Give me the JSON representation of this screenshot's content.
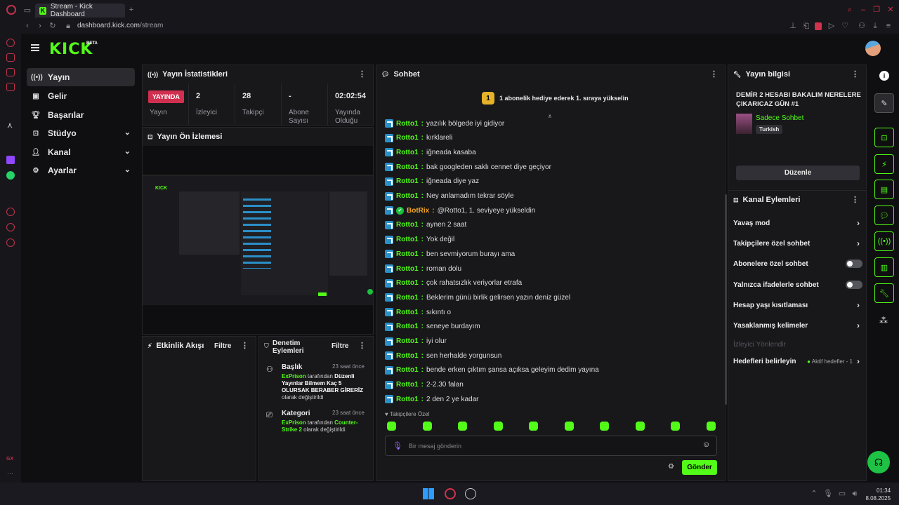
{
  "browser": {
    "tab_title": "Stream - Kick Dashboard",
    "url_domain": "dashboard.kick.com",
    "url_path": "/stream"
  },
  "header": {
    "logo": "KICK",
    "beta": "BETA"
  },
  "nav": [
    {
      "label": "Yayın",
      "icon": "broadcast-icon",
      "active": true
    },
    {
      "label": "Gelir",
      "icon": "wallet-icon"
    },
    {
      "label": "Başarılar",
      "icon": "trophy-icon"
    },
    {
      "label": "Stüdyo",
      "icon": "studio-icon"
    },
    {
      "label": "Kanal",
      "icon": "user-icon"
    },
    {
      "label": "Ayarlar",
      "icon": "gear-icon"
    }
  ],
  "stats": {
    "title": "Yayın İstatistikleri",
    "live_badge": "YAYINDA",
    "items": [
      {
        "value": "",
        "label": "Yayın"
      },
      {
        "value": "2",
        "label": "İzleyici"
      },
      {
        "value": "28",
        "label": "Takipçi"
      },
      {
        "value": "-",
        "label": "Abone Sayısı"
      },
      {
        "value": "02:02:54",
        "label": "Yayında Olduğu"
      }
    ]
  },
  "preview": {
    "title": "Yayın Ön İzlemesi"
  },
  "activity": {
    "title": "Etkinlik Akışı",
    "filter": "Filtre"
  },
  "moderation": {
    "title": "Denetim Eylemleri",
    "filter": "Filtre",
    "items": [
      {
        "type": "Başlık",
        "time": "23 saat önce",
        "user": "ExPrison",
        "mid": " tarafından ",
        "target": "Düzenli Yayınlar Bilmem Kaç 5 OLURSAK BERABER GİRERİZ",
        "suffix": " olarak değiştirildi"
      },
      {
        "type": "Kategori",
        "time": "23 saat önce",
        "user": "ExPrison",
        "mid": " tarafından ",
        "target": "Counter-Strike 2",
        "suffix": " olarak değiştirildi"
      }
    ]
  },
  "chat": {
    "title": "Sohbet",
    "banner_rank": "1",
    "banner_text": "1 abonelik hediye ederek 1. sıraya yükselin",
    "messages": [
      {
        "user": "Rotto1",
        "text": "yazılık bölgede iyi gidiyor"
      },
      {
        "user": "Rotto1",
        "text": "kırklareli"
      },
      {
        "user": "Rotto1",
        "text": "iğneada kasaba"
      },
      {
        "user": "Rotto1",
        "text": "bak googleden saklı cennet diye geçiyor"
      },
      {
        "user": "Rotto1",
        "text": "iğneada diye yaz"
      },
      {
        "user": "Rotto1",
        "text": "Ney anlamadım tekrar söyle"
      },
      {
        "user": "BotRix",
        "text": "@Rotto1, 1. seviyeye yükseldin",
        "bot": true
      },
      {
        "user": "Rotto1",
        "text": "aynen 2 saat"
      },
      {
        "user": "Rotto1",
        "text": "Yok değil"
      },
      {
        "user": "Rotto1",
        "text": "ben sevmiyorum burayı ama"
      },
      {
        "user": "Rotto1",
        "text": "roman dolu"
      },
      {
        "user": "Rotto1",
        "text": "çok rahatsızlık veriyorlar etrafa"
      },
      {
        "user": "Rotto1",
        "text": "Beklerim günü birlik gelirsen yazın deniz güzel"
      },
      {
        "user": "Rotto1",
        "text": "sıkıntı o"
      },
      {
        "user": "Rotto1",
        "text": "seneye burdayım"
      },
      {
        "user": "Rotto1",
        "text": "iyi olur"
      },
      {
        "user": "Rotto1",
        "text": "sen herhalde yorgunsun"
      },
      {
        "user": "Rotto1",
        "text": "bende erken çıktım şansa açıksa geleyim dedim yayına"
      },
      {
        "user": "Rotto1",
        "text": "2-2.30 falan"
      },
      {
        "user": "Rotto1",
        "text": "2 den 2 ye kadar"
      }
    ],
    "followers_only": "Takipçilere Özel",
    "input_placeholder": "Bir mesaj gönderin",
    "send": "Gönder"
  },
  "stream_info": {
    "title": "Yayın bilgisi",
    "stream_title": "DEMİR 2 HESABI BAKALIM NERELERE ÇIKARICAZ GÜN #1",
    "category": "Sadece Sohbet",
    "tag": "Turkish",
    "edit": "Düzenle"
  },
  "channel_actions": {
    "title": "Kanal Eylemleri",
    "rows": [
      {
        "label": "Yavaş mod",
        "kind": "arrow"
      },
      {
        "label": "Takipçilere özel sohbet",
        "kind": "arrow"
      },
      {
        "label": "Abonelere özel sohbet",
        "kind": "toggle",
        "on": false
      },
      {
        "label": "Yalnızca ifadelerle sohbet",
        "kind": "toggle",
        "on": false
      },
      {
        "label": "Hesap yaşı kısıtlaması",
        "kind": "arrow"
      },
      {
        "label": "Yasaklanmış kelimeler",
        "kind": "arrow"
      },
      {
        "label": "İzleyici Yönlendir",
        "kind": "disabled"
      },
      {
        "label": "Hedefleri belirleyin",
        "kind": "goal",
        "extra": "Aktif hedefler - 1"
      }
    ]
  },
  "taskbar": {
    "time": "01:34",
    "date": "8.08.2025"
  }
}
